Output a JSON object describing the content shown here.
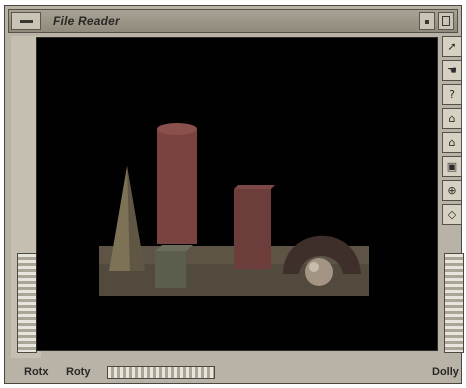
{
  "window": {
    "title": "File Reader"
  },
  "toolbar": {
    "tools": [
      {
        "icon": "pointer-icon",
        "glyph": "➚"
      },
      {
        "icon": "hand-icon",
        "glyph": "☚"
      },
      {
        "icon": "help-icon",
        "glyph": "?"
      },
      {
        "icon": "home-icon",
        "glyph": "⌂"
      },
      {
        "icon": "set-home-icon",
        "glyph": "⌂"
      },
      {
        "icon": "view-all-icon",
        "glyph": "▣"
      },
      {
        "icon": "seek-icon",
        "glyph": "⊕"
      },
      {
        "icon": "projection-icon",
        "glyph": "◇"
      }
    ]
  },
  "thumbwheels": {
    "rotx_label": "Rotx",
    "roty_label": "Roty",
    "dolly_label": "Dolly"
  },
  "scene": {
    "background": "#010101",
    "objects": [
      "cone",
      "cylinder",
      "cube",
      "box",
      "torus",
      "sphere",
      "floor"
    ]
  }
}
